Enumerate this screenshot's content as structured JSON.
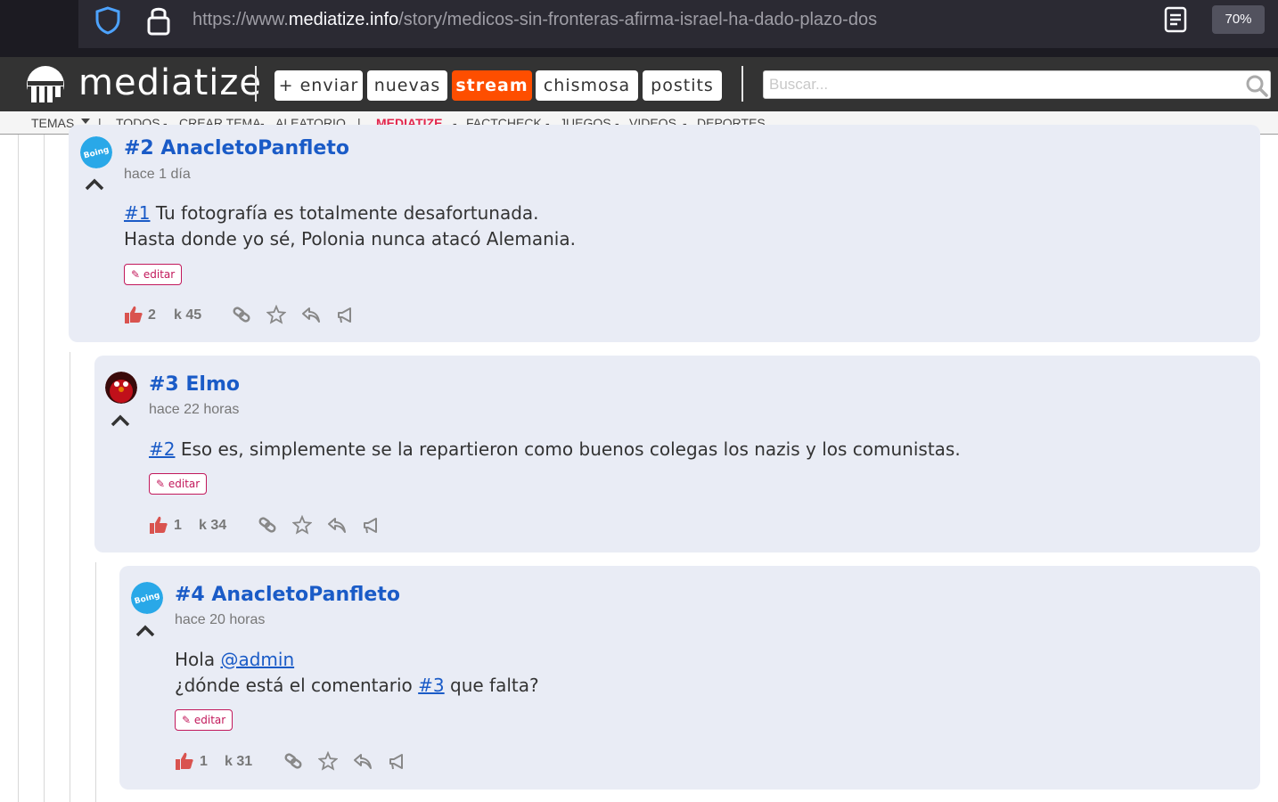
{
  "browser": {
    "url_prefix": "https://www.",
    "url_domain": "mediatize.info",
    "url_path": "/story/medicos-sin-fronteras-afirma-israel-ha-dado-plazo-dos",
    "zoom": "70%"
  },
  "site": {
    "logo_text": "mediatize",
    "nav": [
      "+ enviar",
      "nuevas",
      "stream",
      "chismosa",
      "postits"
    ],
    "active_nav": "stream",
    "search_placeholder": "Buscar...",
    "accent_color": "#fe4e00"
  },
  "subnav": {
    "temas": "TEMAS",
    "items": [
      "TODOS",
      "CREAR TEMA",
      "ALEATORIO"
    ],
    "highlight": "MEDIATIZE",
    "items2": [
      "FACTCHECK",
      "JUEGOS",
      "VIDEOS",
      "DEPORTES"
    ]
  },
  "comments": [
    {
      "title": "#2 AnacletoPanfleto",
      "time": "hace 1 día",
      "lines": [
        {
          "link": "#1",
          "text": " Tu fotografía es totalmente desafortunada."
        },
        {
          "link": "",
          "text": "Hasta donde yo sé, Polonia nunca atacó Alemania."
        }
      ],
      "edit_label": "editar",
      "votes": "2",
      "karma": "k 45",
      "avatar": "boing-avatar"
    },
    {
      "title": "#3 Elmo",
      "time": "hace 22 horas",
      "lines": [
        {
          "link": "#2",
          "text": " Eso es, simplemente se la repartieron como buenos colegas los nazis y los comunistas."
        }
      ],
      "edit_label": "editar",
      "votes": "1",
      "karma": "k 34",
      "avatar": "elmo-avatar"
    },
    {
      "title": "#4 AnacletoPanfleto",
      "time": "hace 20 horas",
      "lines": [
        {
          "prefix": "Hola ",
          "link": "@admin",
          "text": ""
        },
        {
          "prefix": "¿dónde está el comentario ",
          "link": "#3",
          "text": " que falta?"
        }
      ],
      "edit_label": "editar",
      "votes": "1",
      "karma": "k 31",
      "avatar": "boing-avatar"
    }
  ]
}
